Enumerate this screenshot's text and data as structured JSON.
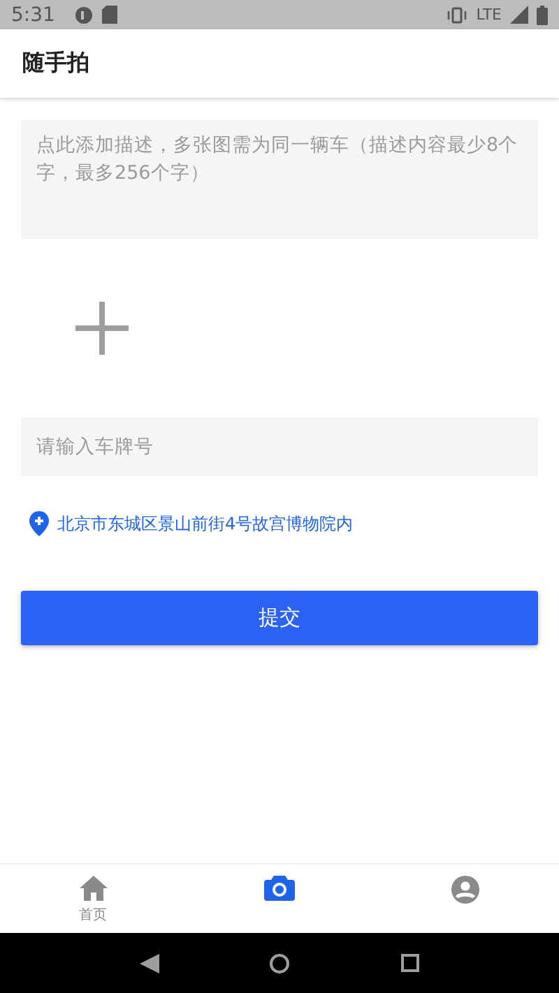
{
  "status_bar": {
    "time": "5:31",
    "network": "LTE"
  },
  "app_bar": {
    "title": "随手拍"
  },
  "description": {
    "placeholder": "点此添加描述，多张图需为同一辆车（描述内容最少8个字，最多256个字）"
  },
  "plate": {
    "placeholder": "请输入车牌号"
  },
  "location": {
    "address": "北京市东城区景山前街4号故宫博物院内"
  },
  "submit": {
    "label": "提交"
  },
  "tabs": [
    {
      "kind": "home",
      "label": "首页",
      "selected": false
    },
    {
      "kind": "camera",
      "selected": true
    },
    {
      "kind": "profile",
      "selected": false
    }
  ]
}
